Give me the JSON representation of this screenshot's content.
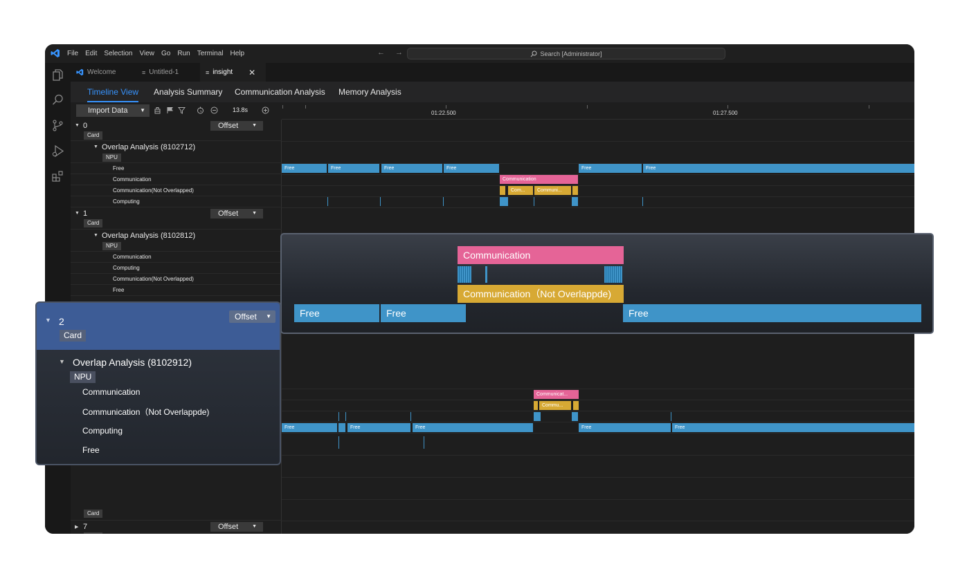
{
  "menu": [
    "File",
    "Edit",
    "Selection",
    "View",
    "Go",
    "Run",
    "Terminal",
    "Help"
  ],
  "nav_arrows": "← →",
  "search": {
    "label": "Search [Administrator]"
  },
  "tabs": [
    {
      "label": "Welcome",
      "icon": "vscode-logo-icon"
    },
    {
      "label": "Untitled-1",
      "icon": "file-lines-icon"
    },
    {
      "label": "insight",
      "icon": "file-lines-icon"
    }
  ],
  "close_glyph": "✕",
  "view_tabs": [
    "Timeline View",
    "Analysis Summary",
    "Communication Analysis",
    "Memory Analysis"
  ],
  "toolbar": {
    "import_label": "Import Data",
    "zoom_value": "13.8s"
  },
  "ruler_labels": [
    "01:22.500",
    "01:27.500"
  ],
  "tree": {
    "offset_label": "Offset",
    "card_label": "Card",
    "npu_label": "NPU",
    "group0": {
      "name": "0",
      "analysis": "Overlap Analysis (8102712)",
      "lanes": [
        "Free",
        "Communication",
        "Communication(Not Overlapped)",
        "Computing"
      ]
    },
    "group1": {
      "name": "1",
      "analysis": "Overlap Analysis (8102812)",
      "lanes": [
        "Communication",
        "Computing",
        "Communication(Not Overlapped)",
        "Free"
      ]
    },
    "group7": {
      "name": "7"
    }
  },
  "timeline": {
    "free_label": "Free",
    "comm_label": "Communication",
    "row0_comm_short": [
      "Com...",
      "Communi..."
    ],
    "row2_comm": "Communicat...",
    "row2_commno": "Commu..."
  },
  "zoom_popup": {
    "comm_label": "Communication",
    "commno_label": "Communication（Not Overlappde)",
    "free_label": "Free"
  },
  "group_popup": {
    "name": "2",
    "card_label": "Card",
    "offset_label": "Offset",
    "analysis": "Overlap Analysis (8102912)",
    "npu_label": "NPU",
    "lanes": [
      "Communication",
      "Communication（Not Overlappde)",
      "Computing",
      "Free"
    ]
  },
  "colors": {
    "free": "#3f94c8",
    "communication": "#e56497",
    "not_overlapped": "#d7a934",
    "accent": "#3794ff",
    "popup_header": "#3d5c96"
  }
}
